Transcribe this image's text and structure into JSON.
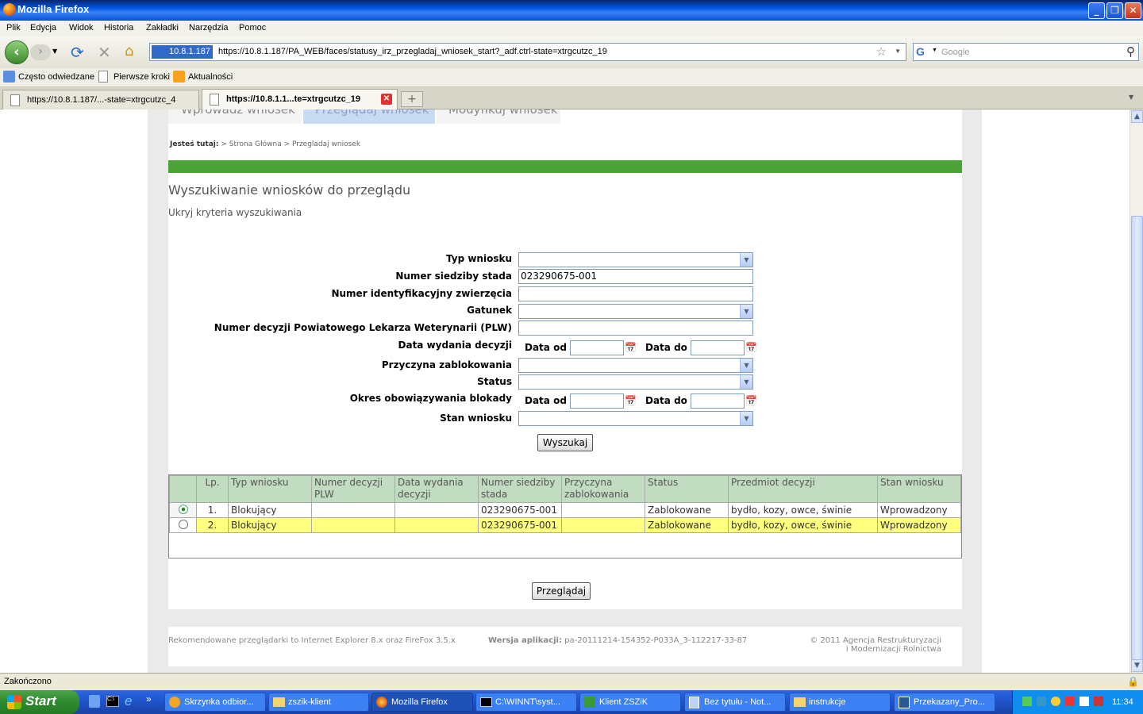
{
  "window": {
    "title": "Mozilla Firefox"
  },
  "menu": [
    "Plik",
    "Edycja",
    "Widok",
    "Historia",
    "Zakładki",
    "Narzędzia",
    "Pomoc"
  ],
  "nav": {
    "site_badge": "10.8.1.187",
    "url": "https://10.8.1.187/PA_WEB/faces/statusy_irz_przegladaj_wniosek_start?_adf.ctrl-state=xtrgcutzc_19",
    "search_placeholder": "Google"
  },
  "bookmarks": [
    "Często odwiedzane",
    "Pierwsze kroki",
    "Aktualności"
  ],
  "tabs": [
    "https://10.8.1.187/...-state=xtrgcutzc_4",
    "https://10.8.1.1...te=xtrgcutzc_19"
  ],
  "page": {
    "top_tabs": [
      "Wprowadź wniosek",
      "Przeglądaj wniosek",
      "Modyfikuj wniosek"
    ],
    "breadcrumb_label": "Jesteś tutaj:",
    "breadcrumb": "> Strona Główna > Przegladaj wniosek",
    "heading": "Wyszukiwanie wniosków do przeglądu",
    "toggle_link": "Ukryj kryteria wyszukiwania",
    "form": {
      "typ": "Typ wniosku",
      "siedziba": "Numer siedziby stada",
      "siedziba_value": "023290675-001",
      "zwierze": "Numer identyfikacyjny zwierzęcia",
      "gatunek": "Gatunek",
      "decyzja": "Numer decyzji Powiatowego Lekarza Weterynarii (PLW)",
      "data_wydania": "Data wydania decyzji",
      "data_od": "Data od",
      "data_do": "Data do",
      "przyczyna": "Przyczyna zablokowania",
      "status": "Status",
      "okres": "Okres obowiązywania blokady",
      "stan": "Stan wniosku",
      "search_button": "Wyszukaj"
    },
    "table": {
      "headers": [
        "Lp.",
        "Typ wniosku",
        "Numer decyzji PLW",
        "Data wydania decyzji",
        "Numer siedziby stada",
        "Przyczyna zablokowania",
        "Status",
        "Przedmiot decyzji",
        "Stan wniosku"
      ],
      "rows": [
        [
          "1.",
          "Blokujący",
          "",
          "",
          "023290675-001",
          "",
          "Zablokowane",
          "bydło, kozy, owce, świnie",
          "Wprowadzony"
        ],
        [
          "2.",
          "Blokujący",
          "",
          "",
          "023290675-001",
          "",
          "Zablokowane",
          "bydło, kozy, owce, świnie",
          "Wprowadzony"
        ]
      ]
    },
    "browse_button": "Przeglądaj",
    "footer": {
      "left": "Rekomendowane przeglądarki to Internet Explorer 8.x oraz FireFox 3.5.x",
      "version_label": "Wersja aplikacji:",
      "version": "pa-20111214-154352-P033A_3-112217-33-87",
      "copyright1": "© 2011 Agencja Restrukturyzacji",
      "copyright2": "i Modernizacji Rolnictwa"
    }
  },
  "status_text": "Zakończono",
  "taskbar": {
    "start": "Start",
    "items": [
      "Skrzynka odbior...",
      "zszik-klient",
      "Mozilla Firefox",
      "C:\\WINNT\\syst...",
      "Klient ZSZiK",
      "Bez tytułu - Not...",
      "instrukcje",
      "Przekazany_Pro..."
    ],
    "clock": "11:34"
  }
}
